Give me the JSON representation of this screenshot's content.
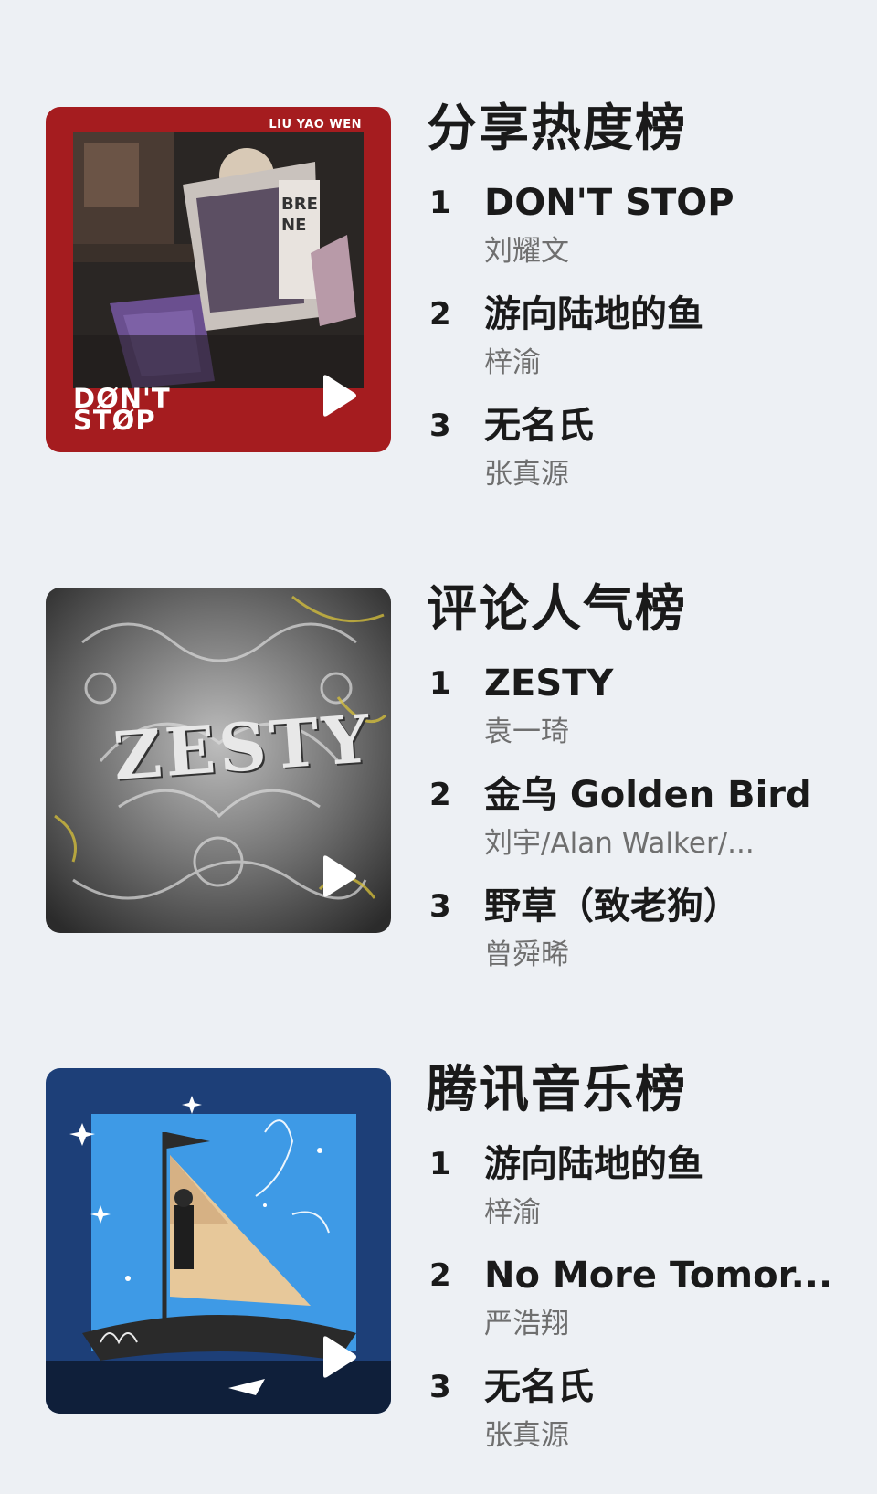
{
  "charts": [
    {
      "title": "分享热度榜",
      "cover": {
        "icon": "album-cover-dont-stop",
        "top_text": "LIU YAO WEN",
        "bottom_text_1": "DØN'T",
        "bottom_text_2": "STØP",
        "frame_color": "#a51c1f"
      },
      "entries": [
        {
          "rank": "1",
          "song": "DON'T STOP",
          "artist": "刘耀文"
        },
        {
          "rank": "2",
          "song": "游向陆地的鱼",
          "artist": "梓渝"
        },
        {
          "rank": "3",
          "song": "无名氏",
          "artist": "张真源"
        }
      ]
    },
    {
      "title": "评论人气榜",
      "cover": {
        "icon": "album-cover-zesty",
        "art_text": "ZESTY",
        "frame_color": "#4a4a4a"
      },
      "entries": [
        {
          "rank": "1",
          "song": "ZESTY",
          "artist": "袁一琦"
        },
        {
          "rank": "2",
          "song": "金乌 Golden Bird",
          "artist": "刘宇/Alan Walker/..."
        },
        {
          "rank": "3",
          "song": "野草（致老狗）",
          "artist": "曾舜晞"
        }
      ]
    },
    {
      "title": "腾讯音乐榜",
      "cover": {
        "icon": "album-cover-sailboat",
        "frame_color": "#1d3f78",
        "accent_color": "#3e9ae6"
      },
      "entries": [
        {
          "rank": "1",
          "song": "游向陆地的鱼",
          "artist": "梓渝"
        },
        {
          "rank": "2",
          "song": "No More Tomor...",
          "artist": "严浩翔"
        },
        {
          "rank": "3",
          "song": "无名氏",
          "artist": "张真源"
        }
      ]
    }
  ]
}
